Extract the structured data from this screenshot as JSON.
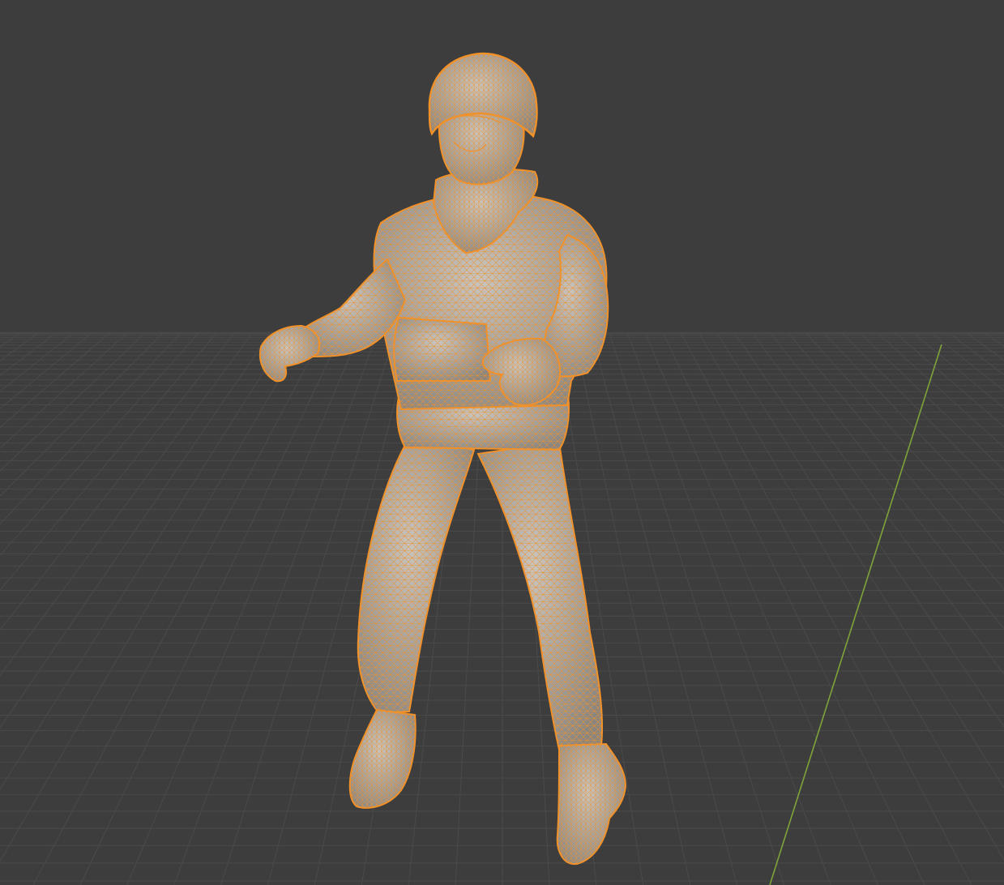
{
  "viewport": {
    "background_color": "#3d3d3d",
    "grid_color": "#4a4a4a",
    "y_axis_color": "#7fa33a"
  },
  "model": {
    "subject": "soldier-figure",
    "display_mode": "wireframe-overlay",
    "selected": true,
    "wire_color": "#f0912a",
    "surface_color": "#a8a4a0"
  }
}
